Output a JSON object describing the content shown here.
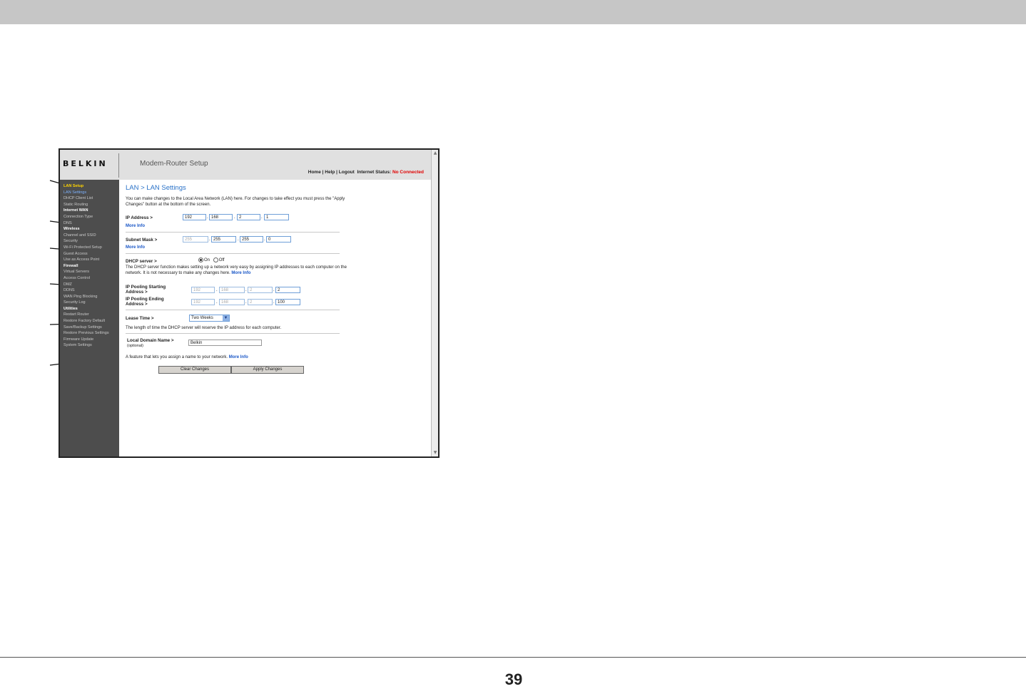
{
  "page_number": "39",
  "app": {
    "logo": "BELKIN",
    "title": "Modem-Router Setup",
    "toplinks": {
      "home": "Home",
      "help": "Help",
      "logout": "Logout",
      "status_label": "Internet Status:",
      "status_value": "No Connected"
    }
  },
  "sidebar": {
    "items": [
      {
        "label": "LAN Setup",
        "kind": "section-current"
      },
      {
        "label": "LAN Settings",
        "kind": "current"
      },
      {
        "label": "DHCP Client List",
        "kind": "item"
      },
      {
        "label": "Static Routing",
        "kind": "item"
      },
      {
        "label": "Internet WAN",
        "kind": "section"
      },
      {
        "label": "Connection Type",
        "kind": "item"
      },
      {
        "label": "DNS",
        "kind": "item"
      },
      {
        "label": "Wireless",
        "kind": "section"
      },
      {
        "label": "Channel and SSID",
        "kind": "item"
      },
      {
        "label": "Security",
        "kind": "item"
      },
      {
        "label": "Wi-Fi Protected Setup",
        "kind": "item"
      },
      {
        "label": "Guest Access",
        "kind": "item"
      },
      {
        "label": "Use as Access Point",
        "kind": "item"
      },
      {
        "label": "Firewall",
        "kind": "section"
      },
      {
        "label": "Virtual Servers",
        "kind": "item"
      },
      {
        "label": "Access Control",
        "kind": "item"
      },
      {
        "label": "DMZ",
        "kind": "item"
      },
      {
        "label": "DDNS",
        "kind": "item"
      },
      {
        "label": "WAN Ping Blocking",
        "kind": "item"
      },
      {
        "label": "Security Log",
        "kind": "item"
      },
      {
        "label": "Utilities",
        "kind": "section"
      },
      {
        "label": "Restart Router",
        "kind": "item"
      },
      {
        "label": "Restore Factory Default",
        "kind": "item"
      },
      {
        "label": "Save/Backup Settings",
        "kind": "item"
      },
      {
        "label": "Restore Previous Settings",
        "kind": "item"
      },
      {
        "label": "Firmware Update",
        "kind": "item"
      },
      {
        "label": "System Settings",
        "kind": "item"
      }
    ]
  },
  "content": {
    "heading": "LAN > LAN Settings",
    "intro": "You can make changes to the Local Area Network (LAN) here. For changes to take effect you must press the \"Apply Changes\" button at the bottom of the screen.",
    "more_info": "More Info",
    "ip_address": {
      "label": "IP Address >",
      "octets": [
        "192",
        "168",
        "2",
        "1"
      ]
    },
    "subnet_mask": {
      "label": "Subnet Mask >",
      "octets": [
        "255",
        "255",
        "255",
        "0"
      ]
    },
    "dhcp": {
      "label": "DHCP server >",
      "on_label": "On",
      "off_label": "Off",
      "selected": "On",
      "description": "The DHCP server function makes setting up a network very easy by assigning IP addresses to each computer on the network. It is not necessary to make any changes here."
    },
    "pool_start": {
      "label_line1": "IP Pooling Starting",
      "label_line2": "Address >",
      "octets": [
        "192",
        "168",
        "2",
        "2"
      ]
    },
    "pool_end": {
      "label_line1": "IP Pooling Ending",
      "label_line2": "Address >",
      "octets": [
        "192",
        "168",
        "2",
        "100"
      ]
    },
    "lease": {
      "label": "Lease Time >",
      "selected": "Two Weeks",
      "description": "The length of time the DHCP server will reserve the IP address for each computer."
    },
    "domain": {
      "label": "Local Domain Name >",
      "sub_label": "(optional)",
      "value": "Belkin",
      "description": "A feature that lets you assign a name to your network."
    },
    "buttons": {
      "clear": "Clear Changes",
      "apply": "Apply Changes"
    }
  }
}
